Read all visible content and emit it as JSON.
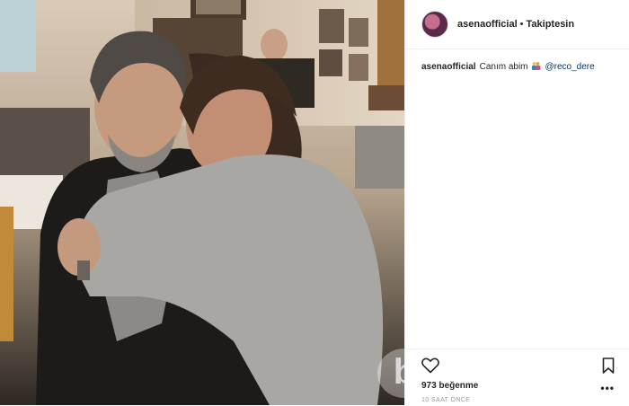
{
  "post": {
    "username": "asenaofficial",
    "separator": "•",
    "follow_status": "Takiptesin",
    "caption": {
      "username": "asenaofficial",
      "text": "Canım abim",
      "emoji": "couple-emoji",
      "mention": "@reco_dere"
    },
    "likes": "973 beğenme",
    "timestamp": "10 SAAT ÖNCE",
    "more": "•••"
  },
  "icons": {
    "like": "heart-icon",
    "save": "bookmark-icon",
    "options": "more-options-icon"
  },
  "watermark": "b"
}
